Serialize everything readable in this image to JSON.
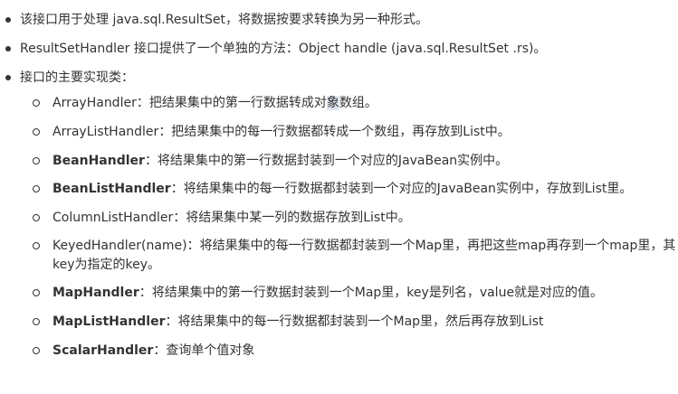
{
  "bullets": [
    {
      "text": "该接口用于处理 java.sql.ResultSet，将数据按要求转换为另一种形式。"
    },
    {
      "text": "ResultSetHandler 接口提供了一个单独的方法：Object handle (java.sql.ResultSet .rs)。"
    },
    {
      "text": "接口的主要实现类："
    }
  ],
  "implementations": [
    {
      "name": "ArrayHandler",
      "desc": "：把结果集中的第一行数据转成对",
      "hl": "象",
      "desc2": "数组。"
    },
    {
      "name": "ArrayListHandler",
      "desc": "：把结果集中的每一行数据都转成一个数组，再存放到List中。"
    },
    {
      "name": "BeanHandler",
      "desc": "：将结果集中的第一行数据封装到一个对应的JavaBean实例中。"
    },
    {
      "name": "BeanListHandler",
      "desc": "：将结果集中的每一行数据都封装到一个对应的JavaBean实例中，存放到List里。"
    },
    {
      "name": "ColumnListHandler",
      "desc": "：将结果集中某一列的数据存放到List中。"
    },
    {
      "name": "KeyedHandler(name)",
      "desc": "：将结果集中的每一行数据都封装到一个Map里，再把这些map再存到一个map里，其key为指定的key。"
    },
    {
      "name": "MapHandler",
      "desc": "：将结果集中的第一行数据封装到一个Map里，key是列名，value就是对应的值。"
    },
    {
      "name": "MapListHandler",
      "desc": "：将结果集中的每一行数据都封装到一个Map里，然后再存放到List"
    },
    {
      "name": "ScalarHandler",
      "desc": "：查询单个值对象"
    }
  ]
}
